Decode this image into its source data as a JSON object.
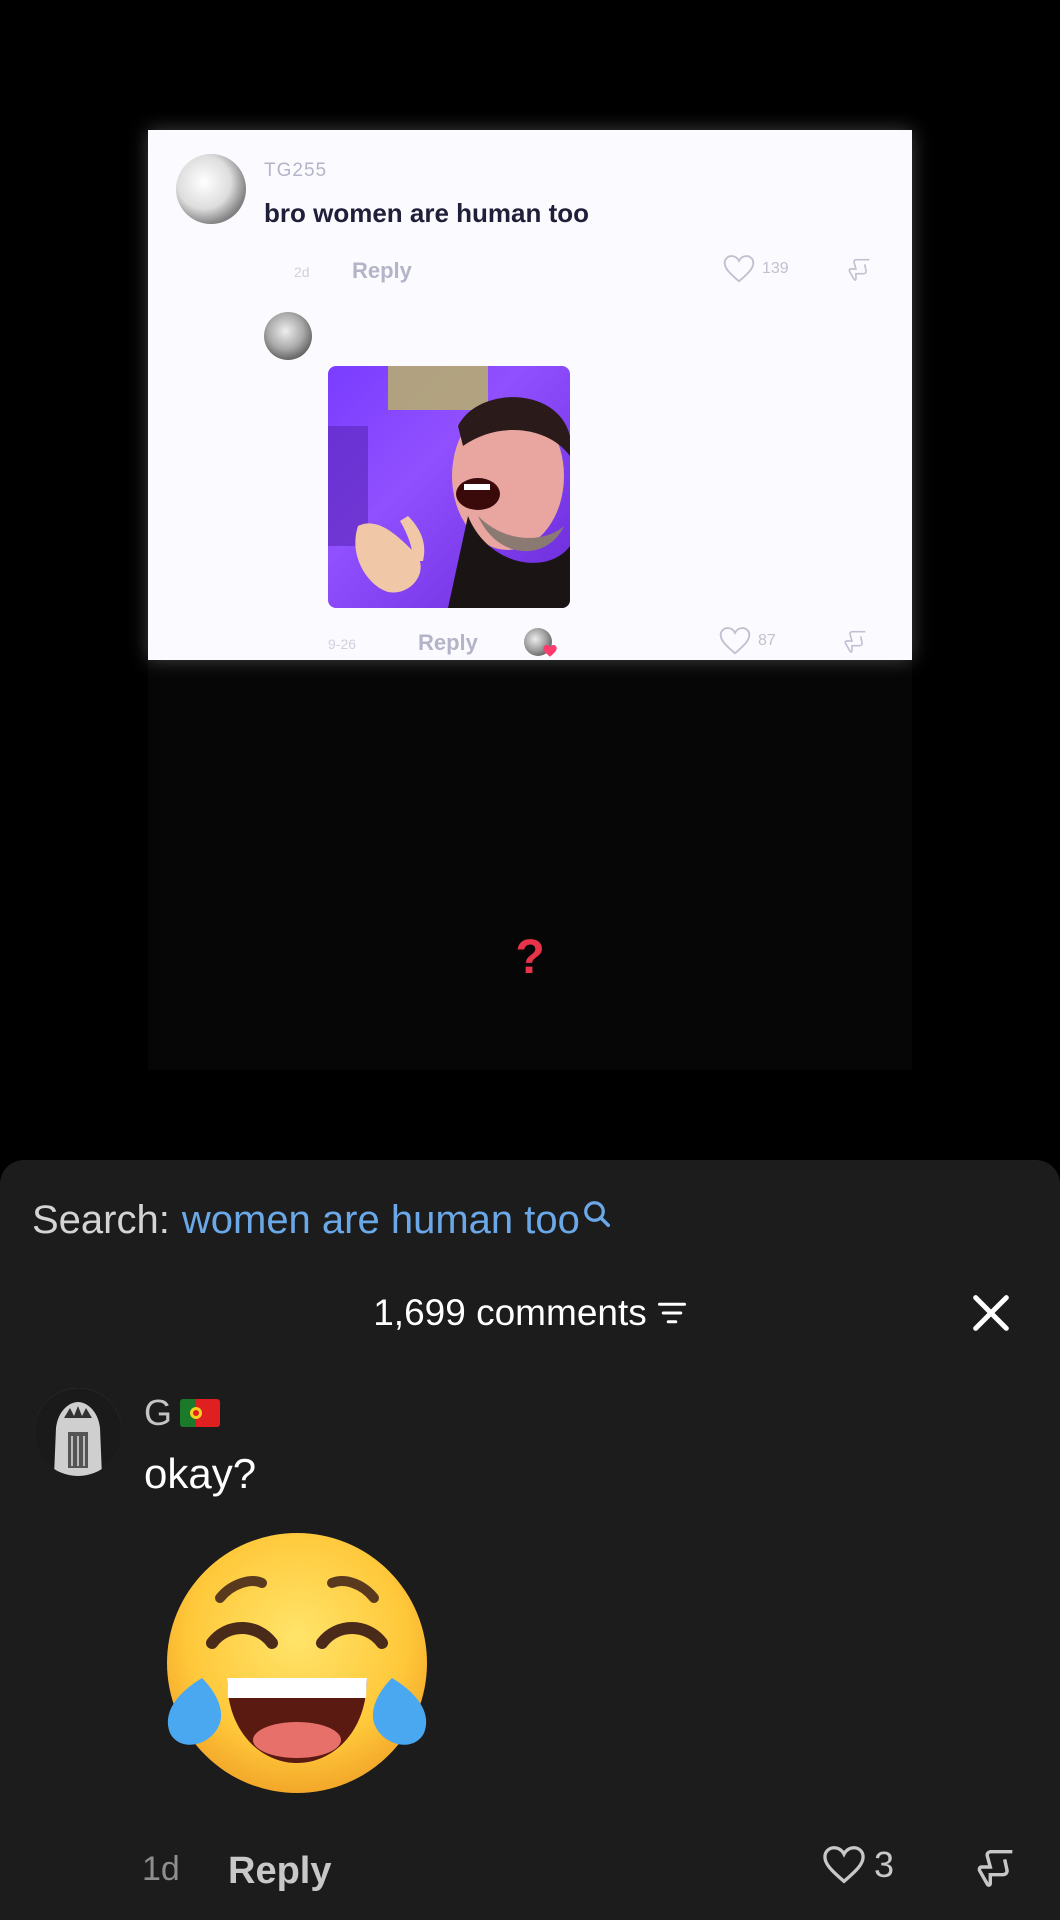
{
  "video": {
    "comment_username": "TG255",
    "comment_text": "bro women are human too",
    "comment_time": "2d",
    "comment_likes": "139",
    "reply_label": "Reply",
    "reply_time": "9-26",
    "reply_likes": "87",
    "overlay_text": "?"
  },
  "sheet": {
    "search_prefix": "Search:",
    "search_query": "women are human too",
    "comments_count": "1,699 comments",
    "comment": {
      "author": "G",
      "text": "okay?",
      "time": "1d",
      "reply_label": "Reply",
      "likes": "3"
    }
  },
  "colors": {
    "sheet_bg": "#1c1c1c",
    "search_link": "#6aa8e8",
    "question_mark": "#e8334a"
  }
}
